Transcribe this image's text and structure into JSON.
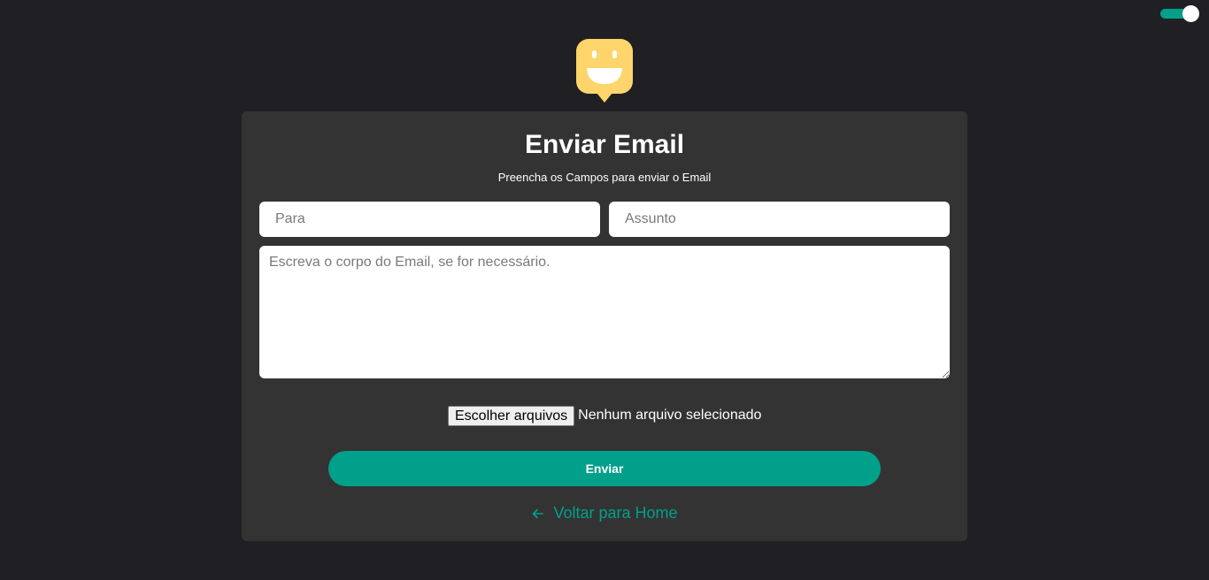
{
  "theme": {
    "accent": "#00a08b",
    "background": "#202024",
    "card": "#333333",
    "logo_color": "#fdd56b"
  },
  "toggle": {
    "icon": "toggle-switch",
    "state": "on"
  },
  "logo": {
    "icon": "smiley-speech-bubble-icon"
  },
  "form": {
    "title": "Enviar Email",
    "subtitle": "Preencha os Campos para enviar o Email",
    "to_placeholder": "Para",
    "to_value": "",
    "subject_placeholder": "Assunto",
    "subject_value": "",
    "body_placeholder": "Escreva o corpo do Email, se for necessário.",
    "body_value": "",
    "file_button_label": "Escolher arquivos",
    "file_status": "Nenhum arquivo selecionado",
    "submit_label": "Enviar",
    "back_label": "Voltar para Home",
    "back_icon": "arrow-left-icon"
  }
}
